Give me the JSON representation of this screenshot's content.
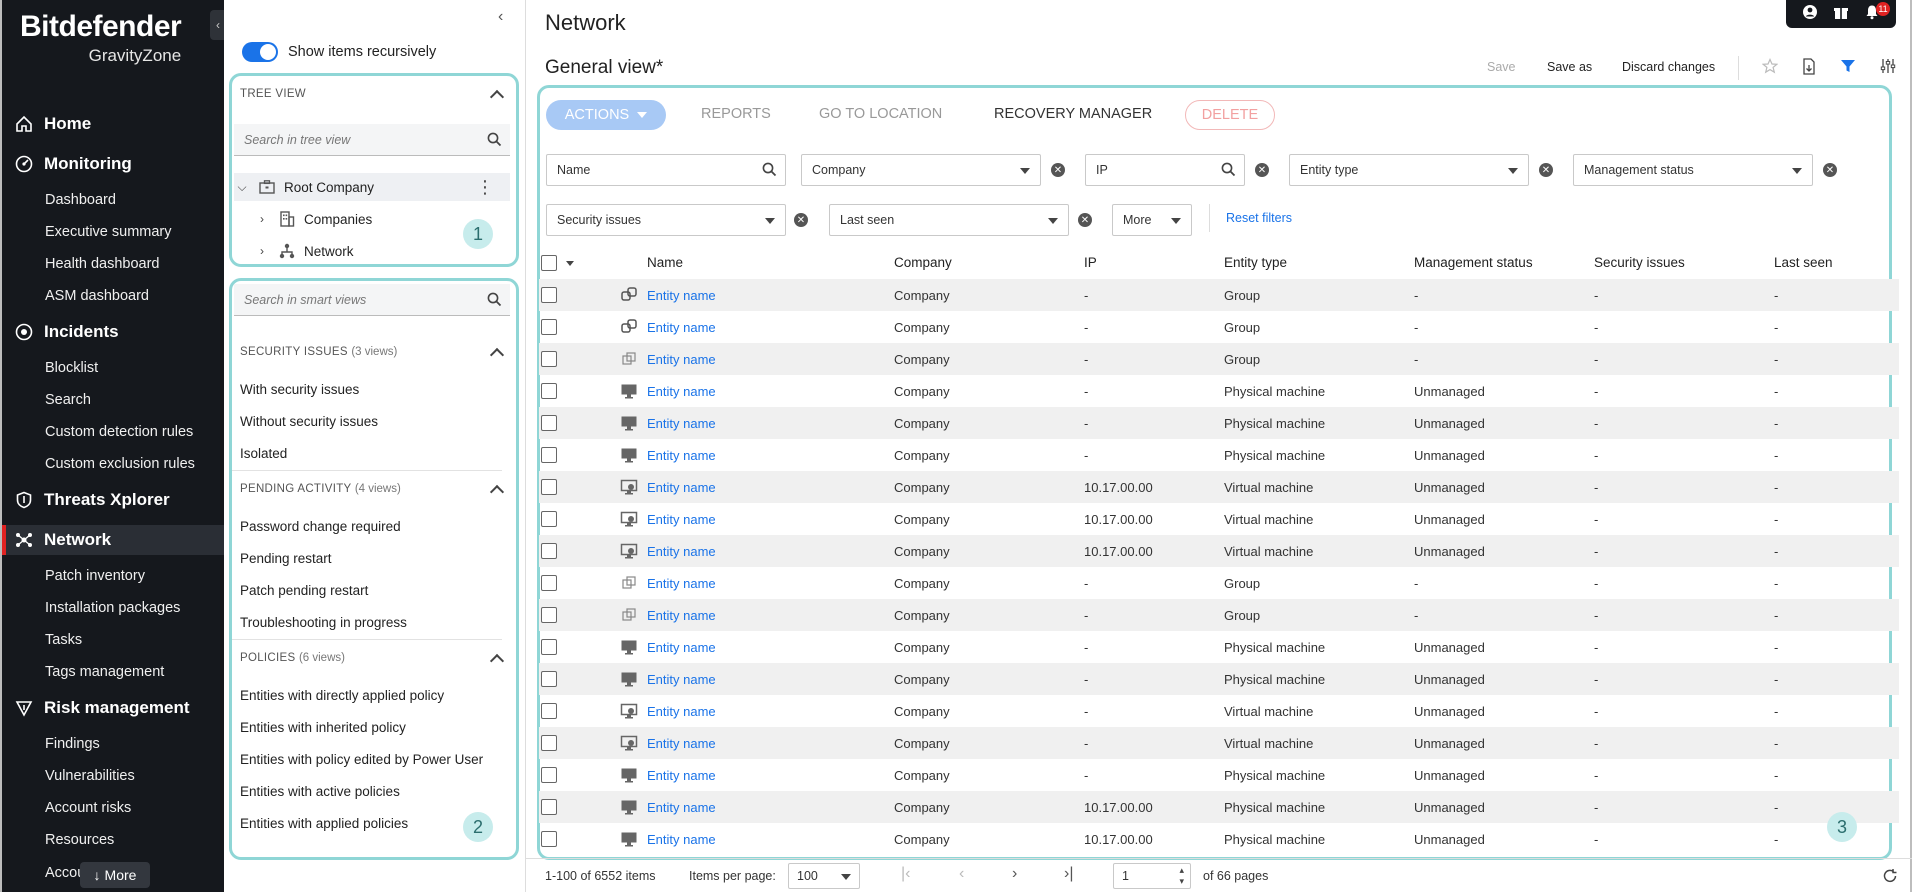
{
  "brand": {
    "name": "Bitdefender",
    "product": "GravityZone"
  },
  "sidebar": {
    "sections": [
      {
        "label": "Home",
        "icon": "home-icon"
      },
      {
        "label": "Monitoring",
        "icon": "monitoring-icon",
        "items": [
          "Dashboard",
          "Executive summary",
          "Health dashboard",
          "ASM dashboard"
        ]
      },
      {
        "label": "Incidents",
        "icon": "incidents-icon",
        "items": [
          "Blocklist",
          "Search",
          "Custom detection rules",
          "Custom exclusion rules"
        ]
      },
      {
        "label": "Threats Xplorer",
        "icon": "shield-icon"
      },
      {
        "label": "Network",
        "icon": "network-icon",
        "active": true,
        "items": [
          "Patch inventory",
          "Installation packages",
          "Tasks",
          "Tags management"
        ]
      },
      {
        "label": "Risk management",
        "icon": "risk-icon",
        "items": [
          "Findings",
          "Vulnerabilities",
          "Account risks",
          "Resources",
          "Accou"
        ]
      }
    ],
    "more_label": "More"
  },
  "midpanel": {
    "show_recursive_label": "Show items recursively",
    "tree_view_label": "TREE VIEW",
    "tree_search_placeholder": "Search in tree view",
    "tree": [
      {
        "label": "Root Company",
        "icon": "briefcase-icon"
      },
      {
        "label": "Companies",
        "icon": "building-icon"
      },
      {
        "label": "Network",
        "icon": "network-tree-icon"
      }
    ],
    "smart_search_placeholder": "Search in smart views",
    "groups": [
      {
        "title": "SECURITY ISSUES",
        "count": "(3 views)",
        "items": [
          "With security issues",
          "Without security issues",
          "Isolated"
        ]
      },
      {
        "title": "PENDING ACTIVITY",
        "count": "(4 views)",
        "items": [
          "Password change required",
          "Pending restart",
          "Patch pending restart",
          "Troubleshooting in progress"
        ]
      },
      {
        "title": "POLICIES",
        "count": "(6 views)",
        "items": [
          "Entities with directly applied policy",
          "Entities with inherited policy",
          "Entities with policy edited by Power User",
          "Entities with active policies",
          "Entities with applied policies"
        ]
      }
    ],
    "badge1": "1",
    "badge2": "2"
  },
  "main": {
    "title": "Network",
    "view_name": "General view*",
    "header_buttons": {
      "save": "Save",
      "save_as": "Save as",
      "discard": "Discard changes"
    },
    "notifications": "11",
    "actions_label": "ACTIONS",
    "tabs": {
      "reports": "REPORTS",
      "go_to_location": "GO TO LOCATION",
      "recovery_manager": "RECOVERY MANAGER",
      "delete": "DELETE"
    },
    "filters": {
      "name": "Name",
      "company": "Company",
      "ip": "IP",
      "entity_type": "Entity type",
      "management_status": "Management status",
      "security_issues": "Security issues",
      "last_seen": "Last seen",
      "more": "More",
      "reset": "Reset filters"
    },
    "columns": [
      "Name",
      "Company",
      "IP",
      "Entity type",
      "Management status",
      "Security issues",
      "Last seen"
    ],
    "rows": [
      {
        "icon": "group-icon",
        "name": "Entity name",
        "company": "Company",
        "ip": "-",
        "type": "Group",
        "status": "-",
        "issues": "-",
        "seen": "-"
      },
      {
        "icon": "group-icon",
        "name": "Entity name",
        "company": "Company",
        "ip": "-",
        "type": "Group",
        "status": "-",
        "issues": "-",
        "seen": "-"
      },
      {
        "icon": "group-outline-icon",
        "name": "Entity name",
        "company": "Company",
        "ip": "-",
        "type": "Group",
        "status": "-",
        "issues": "-",
        "seen": "-"
      },
      {
        "icon": "monitor-icon",
        "name": "Entity name",
        "company": "Company",
        "ip": "-",
        "type": "Physical machine",
        "status": "Unmanaged",
        "issues": "-",
        "seen": "-"
      },
      {
        "icon": "monitor-icon",
        "name": "Entity name",
        "company": "Company",
        "ip": "-",
        "type": "Physical machine",
        "status": "Unmanaged",
        "issues": "-",
        "seen": "-"
      },
      {
        "icon": "monitor-icon",
        "name": "Entity name",
        "company": "Company",
        "ip": "-",
        "type": "Physical machine",
        "status": "Unmanaged",
        "issues": "-",
        "seen": "-"
      },
      {
        "icon": "vm-icon",
        "name": "Entity name",
        "company": "Company",
        "ip": "10.17.00.00",
        "type": "Virtual machine",
        "status": "Unmanaged",
        "issues": "-",
        "seen": "-"
      },
      {
        "icon": "vm-icon",
        "name": "Entity name",
        "company": "Company",
        "ip": "10.17.00.00",
        "type": "Virtual machine",
        "status": "Unmanaged",
        "issues": "-",
        "seen": "-"
      },
      {
        "icon": "vm-icon",
        "name": "Entity name",
        "company": "Company",
        "ip": "10.17.00.00",
        "type": "Virtual machine",
        "status": "Unmanaged",
        "issues": "-",
        "seen": "-"
      },
      {
        "icon": "group-outline-icon",
        "name": "Entity name",
        "company": "Company",
        "ip": "-",
        "type": "Group",
        "status": "-",
        "issues": "-",
        "seen": "-"
      },
      {
        "icon": "group-outline-icon",
        "name": "Entity name",
        "company": "Company",
        "ip": "-",
        "type": "Group",
        "status": "-",
        "issues": "-",
        "seen": "-"
      },
      {
        "icon": "monitor-icon",
        "name": "Entity name",
        "company": "Company",
        "ip": "-",
        "type": "Physical machine",
        "status": "Unmanaged",
        "issues": "-",
        "seen": "-"
      },
      {
        "icon": "monitor-icon",
        "name": "Entity name",
        "company": "Company",
        "ip": "-",
        "type": "Physical machine",
        "status": "Unmanaged",
        "issues": "-",
        "seen": "-"
      },
      {
        "icon": "vm-icon",
        "name": "Entity name",
        "company": "Company",
        "ip": "-",
        "type": "Virtual machine",
        "status": "Unmanaged",
        "issues": "-",
        "seen": "-"
      },
      {
        "icon": "vm-icon",
        "name": "Entity name",
        "company": "Company",
        "ip": "-",
        "type": "Virtual machine",
        "status": "Unmanaged",
        "issues": "-",
        "seen": "-"
      },
      {
        "icon": "monitor-icon",
        "name": "Entity name",
        "company": "Company",
        "ip": "-",
        "type": "Physical machine",
        "status": "Unmanaged",
        "issues": "-",
        "seen": "-"
      },
      {
        "icon": "monitor-icon",
        "name": "Entity name",
        "company": "Company",
        "ip": "10.17.00.00",
        "type": "Physical machine",
        "status": "Unmanaged",
        "issues": "-",
        "seen": "-"
      },
      {
        "icon": "monitor-icon",
        "name": "Entity name",
        "company": "Company",
        "ip": "10.17.00.00",
        "type": "Physical machine",
        "status": "Unmanaged",
        "issues": "-",
        "seen": "-"
      }
    ],
    "badge3": "3",
    "footer": {
      "range": "1-100 of 6552 items",
      "per_page_label": "Items per page:",
      "per_page": "100",
      "page": "1",
      "of_pages": "of 66 pages"
    }
  },
  "colors": {
    "accent": "#1a73e8",
    "sidebar_bg": "#15181d",
    "active_bar": "#e02222",
    "highlight": "#8fd6d6"
  }
}
